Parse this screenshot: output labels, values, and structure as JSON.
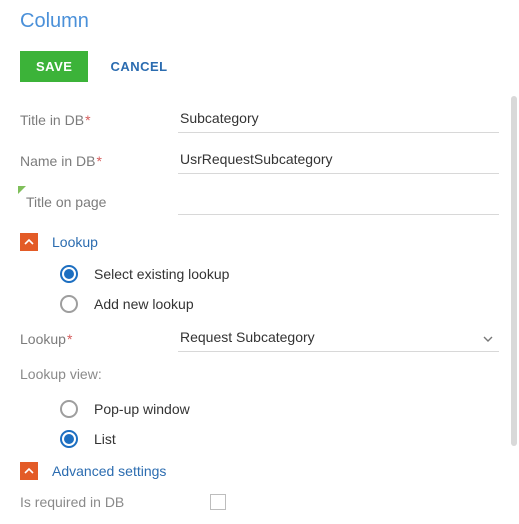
{
  "page": {
    "title": "Column"
  },
  "actions": {
    "save": "SAVE",
    "cancel": "CANCEL"
  },
  "fields": {
    "title_in_db": {
      "label": "Title in DB",
      "value": "Subcategory"
    },
    "name_in_db": {
      "label": "Name in DB",
      "value": "UsrRequestSubcategory"
    },
    "title_on_page": {
      "label": "Title on page",
      "value": ""
    },
    "lookup": {
      "label": "Lookup",
      "value": "Request Subcategory"
    },
    "lookup_view": {
      "label": "Lookup view:"
    },
    "is_required": {
      "label": "Is required in DB"
    }
  },
  "sections": {
    "lookup": "Lookup",
    "advanced": "Advanced settings"
  },
  "radios": {
    "select_existing": "Select existing lookup",
    "add_new": "Add new lookup",
    "popup": "Pop-up window",
    "list": "List"
  }
}
